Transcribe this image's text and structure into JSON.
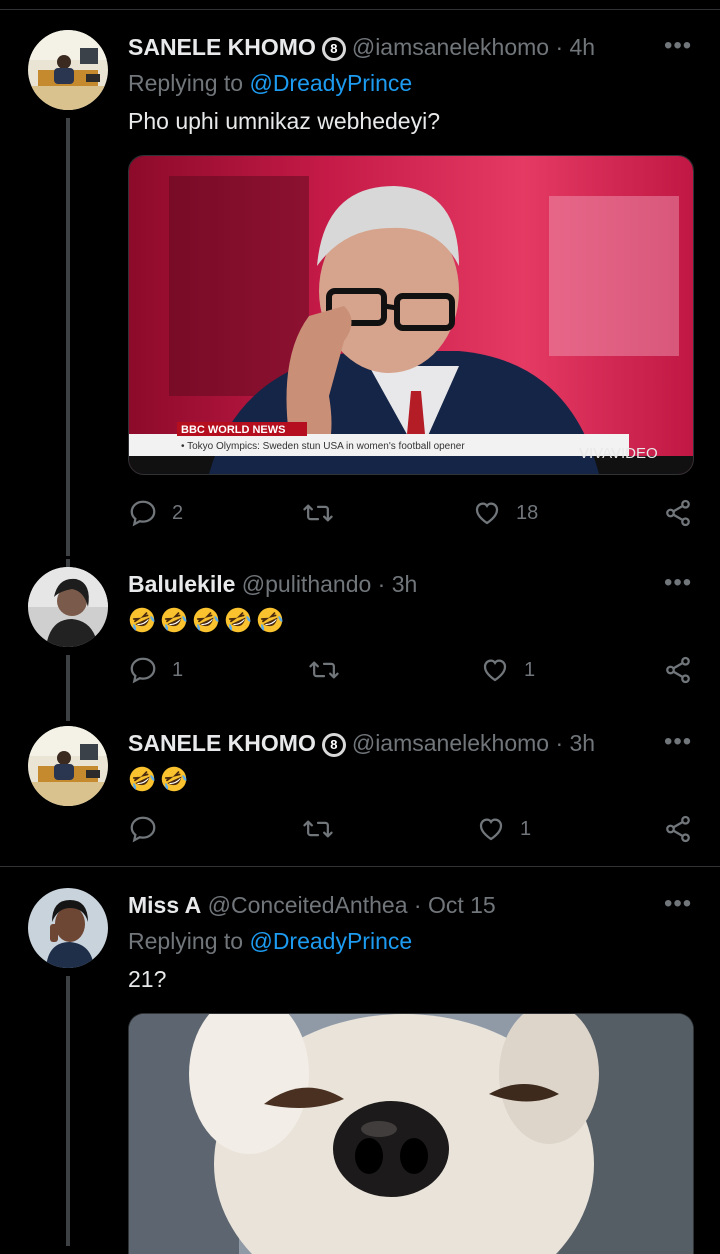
{
  "tweets": [
    {
      "name": "SANELE KHOMO",
      "badge": "8",
      "handle": "@iamsanelekhomo",
      "sep": "·",
      "time": "4h",
      "replying_prefix": "Replying to",
      "replying_to": "@DreadyPrince",
      "text": "Pho uphi umnikaz webhedeyi?",
      "media": {
        "kind": "news-broadcast-screenshot",
        "brand": "BBC",
        "channel": "WORLD NEWS",
        "ticker": "• Tokyo Olympics: Sweden stun USA in women's football opener",
        "watermark": "VIVAVIDEO"
      },
      "replies": "2",
      "retweets": "",
      "likes": "18"
    },
    {
      "name": "Balulekile",
      "handle": "@pulithando",
      "sep": "·",
      "time": "3h",
      "emoji_count": 5,
      "emoji_name": "rolling-on-floor-laughing",
      "replies": "1",
      "retweets": "",
      "likes": "1"
    },
    {
      "name": "SANELE KHOMO",
      "badge": "8",
      "handle": "@iamsanelekhomo",
      "sep": "·",
      "time": "3h",
      "emoji_count": 2,
      "emoji_name": "rolling-on-floor-laughing",
      "replies": "",
      "retweets": "",
      "likes": "1"
    },
    {
      "name": "Miss A",
      "handle": "@ConceitedAnthea",
      "sep": "·",
      "time": "Oct 15",
      "replying_prefix": "Replying to",
      "replying_to": "@DreadyPrince",
      "text": "21?",
      "media": {
        "kind": "dog-closeup-photo"
      }
    }
  ],
  "colors": {
    "background": "#000000",
    "accent": "#1d9bf0",
    "muted": "#71767b",
    "text": "#e7e9ea",
    "divider": "#2f3336"
  },
  "icons": [
    "reply-icon",
    "retweet-icon",
    "like-icon",
    "share-icon",
    "more-icon",
    "verified-badge-icon"
  ]
}
